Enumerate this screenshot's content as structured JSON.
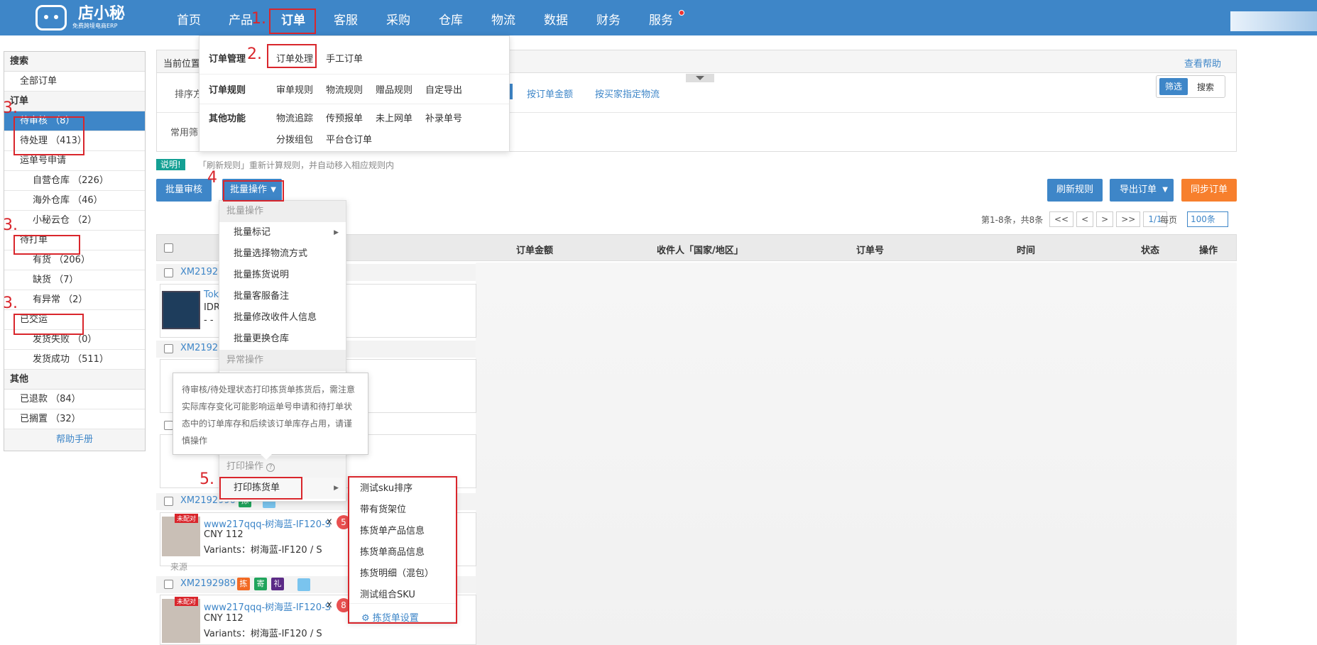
{
  "header": {
    "logo_title": "店小秘",
    "logo_subtitle": "免费跨境电商ERP",
    "nav": [
      {
        "label": "首页"
      },
      {
        "label": "产品"
      },
      {
        "label": "订单"
      },
      {
        "label": "客服"
      },
      {
        "label": "采购"
      },
      {
        "label": "仓库"
      },
      {
        "label": "物流"
      },
      {
        "label": "数据"
      },
      {
        "label": "财务"
      },
      {
        "label": "服务"
      }
    ]
  },
  "order_menu": {
    "rows": [
      {
        "title": "订单管理",
        "links": [
          "订单处理",
          "手工订单"
        ]
      },
      {
        "title": "订单规则",
        "links": [
          "审单规则",
          "物流规则",
          "赠品规则",
          "自定导出"
        ]
      },
      {
        "title": "其他功能",
        "links": [
          "物流追踪",
          "传预报单",
          "未上网单",
          "补录单号",
          "分拨组包",
          "平台仓订单"
        ]
      }
    ]
  },
  "sidebar": {
    "search_header": "搜索",
    "all_orders": "全部订单",
    "order_header": "订单",
    "items": [
      {
        "label": "待审核 （8）"
      },
      {
        "label": "待处理 （413）"
      },
      {
        "label": "运单号申请"
      },
      {
        "label": "自营仓库 （226）"
      },
      {
        "label": "海外仓库 （46）"
      },
      {
        "label": "小秘云仓 （2）"
      },
      {
        "label": "待打单"
      },
      {
        "label": "有货 （206）"
      },
      {
        "label": "缺货 （7）"
      },
      {
        "label": "有异常 （2）"
      },
      {
        "label": "已交运"
      },
      {
        "label": "发货失败 （0）"
      },
      {
        "label": "发货成功 （511）"
      }
    ],
    "other_header": "其他",
    "other_items": [
      {
        "label": "已退款 （84）"
      },
      {
        "label": "已搁置 （32）"
      }
    ],
    "help": "帮助手册"
  },
  "filter": {
    "breadcrumb_label": "当前位置",
    "help_link": "查看帮助",
    "sort_label": "排序方",
    "common_label": "常用筛",
    "sort_links": [
      "按订单金额",
      "按买家指定物流"
    ],
    "toggle": [
      "筛选",
      "搜索"
    ]
  },
  "notice": {
    "badge": "说明!",
    "text": "「刷新规则」重新计算规则，并自动移入相应规则内"
  },
  "toolbar": {
    "batch_review": "批量审核",
    "batch_ops": "批量操作",
    "refresh_rules": "刷新规则",
    "export": "导出订单",
    "sync": "同步订单"
  },
  "pager": {
    "summary": "第1-8条，共8条",
    "buttons": [
      "<<",
      "<",
      ">",
      ">>"
    ],
    "page": "1/1",
    "per_page_label": "每页",
    "per_page": "100条"
  },
  "table": {
    "headers": [
      "订单金额",
      "收件人「国家/地区」",
      "订单号",
      "时间",
      "状态",
      "操作"
    ]
  },
  "orders": [
    {
      "id": "XM21929",
      "product": "Tok",
      "line2": "IDR",
      "line3": "- -"
    },
    {
      "id": "XM21929"
    },
    {
      "id": "XM2192990",
      "tags": [
        "拣"
      ],
      "badge": "未配对",
      "product": "www217qqq-树海蓝-IF120-S",
      "qty_x": "x",
      "qty": "5",
      "price": "CNY 112",
      "variants": "Variants：树海蓝-IF120 / S",
      "source": "来源"
    },
    {
      "id": "XM2192989",
      "tags": [
        "拣",
        "寄",
        "礼"
      ],
      "badge": "未配对",
      "product": "www217qqq-树海蓝-IF120-S",
      "qty_x": "x",
      "qty": "8",
      "price": "CNY 112",
      "variants": "Variants：树海蓝-IF120 / S"
    }
  ],
  "batch_menu": {
    "group1": "批量操作",
    "items": [
      "批量标记",
      "批量选择物流方式",
      "批量拣货说明",
      "批量客服备注",
      "批量修改收件人信息",
      "批量更换仓库"
    ],
    "group2": "异常操作",
    "tooltip": "待审核/待处理状态打印拣货单拣货后，需注意实际库存变化可能影响运单号申请和待打单状态中的订单库存和后续该订单库存占用，请谨慎操作",
    "group3": "打印操作",
    "print_item": "打印拣货单"
  },
  "print_menu": {
    "items": [
      "测试sku排序",
      "带有货架位",
      "拣货单产品信息",
      "拣货单商品信息",
      "拣货明细（混包）",
      "测试组合SKU"
    ],
    "settings": "拣货单设置"
  },
  "annotations": [
    "1.",
    "2.",
    "3.",
    "3.",
    "3.",
    "4",
    "5."
  ],
  "colors": {
    "primary": "#3e86c8",
    "orange": "#f77f2d",
    "annotation": "#d9262c"
  }
}
